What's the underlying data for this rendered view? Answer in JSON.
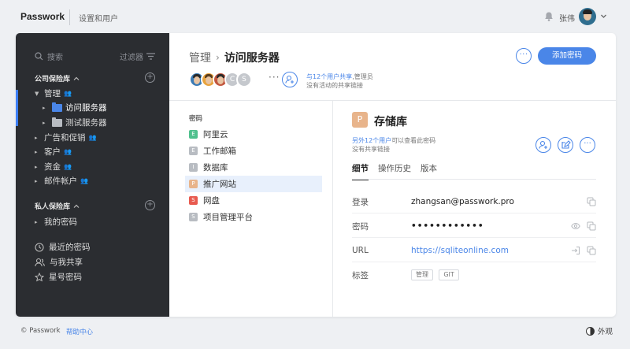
{
  "topbar": {
    "logo": "Passwork",
    "settings_link": "设置和用户",
    "username": "张伟"
  },
  "sidebar": {
    "search_placeholder": "搜索",
    "filter_label": "过滤器",
    "company_vault": "公司保险库",
    "items": [
      {
        "label": "管理"
      },
      {
        "label": "访问服务器"
      },
      {
        "label": "测试服务器"
      },
      {
        "label": "广告和促销"
      },
      {
        "label": "客户"
      },
      {
        "label": "资金"
      },
      {
        "label": "邮件帐户"
      }
    ],
    "private_vault": "私人保险库",
    "my_passwords": "我的密码",
    "recent": "最近的密码",
    "shared_with_me": "与我共享",
    "starred": "星号密码"
  },
  "header": {
    "crumb_parent": "管理",
    "crumb_current": "访问服务器",
    "avatar_letters": [
      "C",
      "S"
    ],
    "share_users": "与12个用户共享",
    "share_role": ",管理员",
    "share_no_link": "没有活动的共享链接",
    "add_password": "添加密码"
  },
  "password_list": {
    "title": "密码",
    "items": [
      {
        "letter": "E",
        "label": "阿里云",
        "color": "#4fc08d"
      },
      {
        "letter": "E",
        "label": "工作邮箱",
        "color": "#b8bcc2"
      },
      {
        "letter": "I",
        "label": "数据库",
        "color": "#b8bcc2"
      },
      {
        "letter": "P",
        "label": "推广网站",
        "color": "#e8b48b"
      },
      {
        "letter": "S",
        "label": "网盘",
        "color": "#e85a4f"
      },
      {
        "letter": "S",
        "label": "项目管理平台",
        "color": "#b8bcc2"
      }
    ],
    "active_index": 3
  },
  "detail": {
    "icon_letter": "P",
    "title": "存储库",
    "share_users": "另外12个用户",
    "share_suffix": "可以查看此密码",
    "share_no_link": "没有共享链接",
    "tabs": [
      "细节",
      "操作历史",
      "版本"
    ],
    "fields": {
      "login_label": "登录",
      "login_value": "zhangsan@passwork.pro",
      "password_label": "密码",
      "password_value": "••••••••••••",
      "url_label": "URL",
      "url_value": "https://sqliteonline.com",
      "tags_label": "标签",
      "tags": [
        "管理",
        "GIT"
      ]
    }
  },
  "footer": {
    "copyright": "© Passwork",
    "help": "帮助中心",
    "appearance": "外观"
  }
}
